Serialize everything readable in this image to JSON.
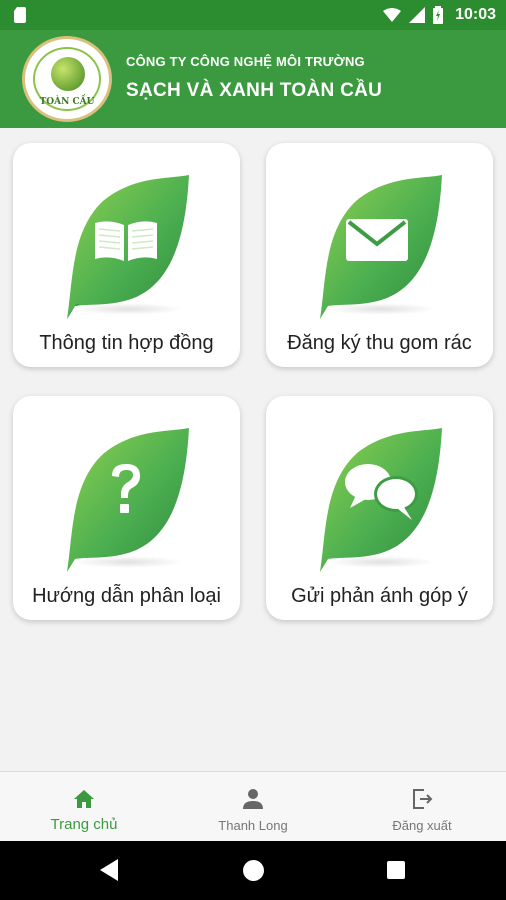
{
  "status_bar": {
    "time": "10:03"
  },
  "header": {
    "logo_text": "TOÀN CẦU",
    "company_line1": "CÔNG TY CÔNG NGHỆ MÔI TRƯỜNG",
    "company_line2": "SẠCH VÀ XANH TOÀN CẦU"
  },
  "menu": [
    {
      "label": "Thông tin hợp đồng",
      "icon": "book-icon"
    },
    {
      "label": "Đăng ký thu gom rác",
      "icon": "mail-icon"
    },
    {
      "label": "Hướng dẫn phân loại",
      "icon": "question-icon"
    },
    {
      "label": "Gửi phản ánh góp ý",
      "icon": "chat-bubbles-icon"
    }
  ],
  "bottom_nav": {
    "items": [
      {
        "label": "Trang chủ",
        "icon": "home-icon",
        "active": true
      },
      {
        "label": "Thanh Long",
        "icon": "user-icon",
        "active": false
      },
      {
        "label": "Đăng xuất",
        "icon": "logout-icon",
        "active": false
      }
    ]
  },
  "colors": {
    "primary": "#3b9a40",
    "status_bar": "#2b8c30",
    "leaf_light": "#7cc84a",
    "leaf_dark": "#2e8b3e"
  }
}
